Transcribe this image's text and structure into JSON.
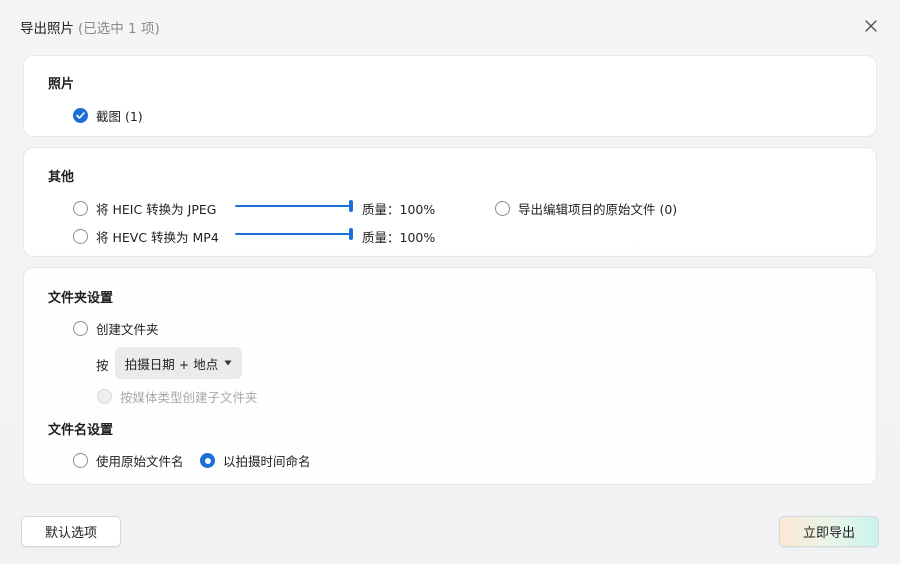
{
  "title": {
    "main": "导出照片",
    "sub": "(已选中 1 项)"
  },
  "photos": {
    "heading": "照片",
    "screenshot_label": "截图 (1)"
  },
  "other": {
    "heading": "其他",
    "heic": {
      "label": "将 HEIC 转换为 JPEG",
      "quality_text": "质量：100%",
      "quality_value": 100
    },
    "hevc": {
      "label": "将 HEVC 转换为 MP4",
      "quality_text": "质量：100%",
      "quality_value": 100
    },
    "export_originals_label": "导出编辑项目的原始文件 (0)"
  },
  "folder": {
    "heading": "文件夹设置",
    "create_folder_label": "创建文件夹",
    "by_label": "按",
    "dropdown_value": "拍摄日期 + 地点",
    "subfolder_label": "按媒体类型创建子文件夹"
  },
  "filename": {
    "heading": "文件名设置",
    "original_label": "使用原始文件名",
    "time_label": "以拍摄时间命名"
  },
  "buttons": {
    "default_label": "默认选项",
    "export_label": "立即导出"
  },
  "colors": {
    "accent": "#1a6fd8"
  }
}
